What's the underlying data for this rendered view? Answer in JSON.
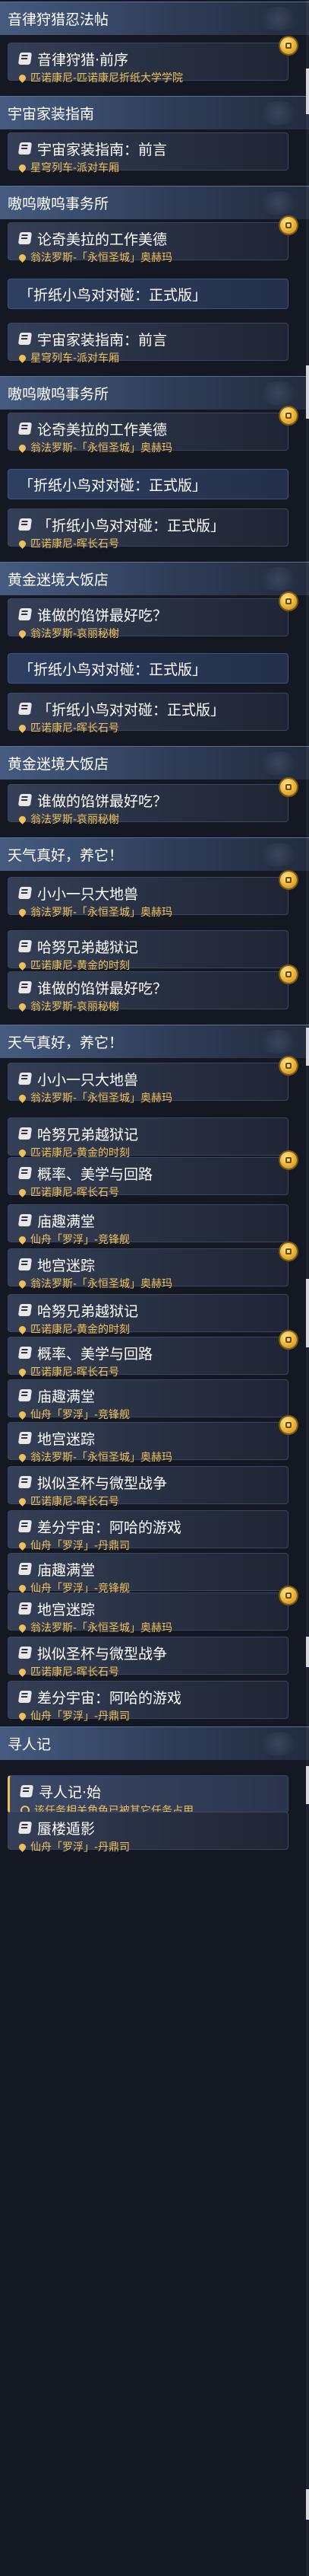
{
  "items": [
    {
      "type": "header",
      "text": "音律狩猎忍法帖"
    },
    {
      "type": "card",
      "title": "音律狩猎·前序",
      "sub": "匹诺康尼-匹诺康尼折纸大学学院",
      "icon": "pin",
      "badge": true
    },
    {
      "type": "header",
      "text": "宇宙家装指南"
    },
    {
      "type": "card",
      "title": "宇宙家装指南：前言",
      "sub": "星穹列车-派对车厢",
      "icon": "pin",
      "badge": false
    },
    {
      "type": "header",
      "text": "嗷呜嗷呜事务所"
    },
    {
      "type": "card",
      "title": "论奇美拉的工作美德",
      "sub": "翁法罗斯-「永恒圣城」奥赫玛",
      "icon": "pin",
      "badge": true
    },
    {
      "type": "banner",
      "title": "「折纸小鸟对对碰：正式版」"
    },
    {
      "type": "card",
      "title": "宇宙家装指南：前言",
      "sub": "星穹列车-派对车厢",
      "icon": "pin",
      "badge": false
    },
    {
      "type": "header",
      "text": "嗷呜嗷呜事务所"
    },
    {
      "type": "card",
      "title": "论奇美拉的工作美德",
      "sub": "翁法罗斯-「永恒圣城」奥赫玛",
      "icon": "pin",
      "badge": true
    },
    {
      "type": "banner",
      "title": "「折纸小鸟对对碰：正式版」"
    },
    {
      "type": "card",
      "title": "「折纸小鸟对对碰：正式版」",
      "sub": "匹诺康尼-晖长石号",
      "icon": "pin",
      "badge": false
    },
    {
      "type": "header",
      "text": "黄金迷境大饭店"
    },
    {
      "type": "card",
      "title": "谁做的馅饼最好吃？",
      "sub": "翁法罗斯-哀丽秘榭",
      "icon": "pin",
      "badge": true
    },
    {
      "type": "banner",
      "title": "「折纸小鸟对对碰：正式版」"
    },
    {
      "type": "card",
      "title": "「折纸小鸟对对碰：正式版」",
      "sub": "匹诺康尼-晖长石号",
      "icon": "pin",
      "badge": false
    },
    {
      "type": "header",
      "text": "黄金迷境大饭店"
    },
    {
      "type": "card",
      "title": "谁做的馅饼最好吃？",
      "sub": "翁法罗斯-哀丽秘榭",
      "icon": "pin",
      "badge": true
    },
    {
      "type": "header",
      "text": "天气真好，养它！"
    },
    {
      "type": "card",
      "title": "小小一只大地兽",
      "sub": "翁法罗斯-「永恒圣城」奥赫玛",
      "icon": "pin",
      "badge": true
    },
    {
      "type": "card",
      "title": "哈努兄弟越狱记",
      "sub": "匹诺康尼-黄金的时刻",
      "icon": "pin",
      "badge": false
    },
    {
      "type": "card",
      "title": "谁做的馅饼最好吃？",
      "sub": "翁法罗斯-哀丽秘榭",
      "icon": "pin",
      "badge": true
    },
    {
      "type": "header",
      "text": "天气真好，养它！"
    },
    {
      "type": "card",
      "title": "小小一只大地兽",
      "sub": "翁法罗斯-「永恒圣城」奥赫玛",
      "icon": "pin",
      "badge": true
    },
    {
      "type": "card",
      "title": "哈努兄弟越狱记",
      "sub": "匹诺康尼-黄金的时刻",
      "icon": "pin",
      "badge": false
    },
    {
      "type": "card",
      "title": "概率、美学与回路",
      "sub": "匹诺康尼-晖长石号",
      "icon": "pin",
      "badge": true
    },
    {
      "type": "card",
      "title": "庙趣满堂",
      "sub": "仙舟「罗浮」-竞锋舰",
      "icon": "pin",
      "badge": false
    },
    {
      "type": "card",
      "title": "地宫迷踪",
      "sub": "翁法罗斯-「永恒圣城」奥赫玛",
      "icon": "pin",
      "badge": true
    },
    {
      "type": "card",
      "title": "哈努兄弟越狱记",
      "sub": "匹诺康尼-黄金的时刻",
      "icon": "pin",
      "badge": false
    },
    {
      "type": "card",
      "title": "概率、美学与回路",
      "sub": "匹诺康尼-晖长石号",
      "icon": "pin",
      "badge": true
    },
    {
      "type": "card",
      "title": "庙趣满堂",
      "sub": "仙舟「罗浮」-竞锋舰",
      "icon": "pin",
      "badge": false
    },
    {
      "type": "card",
      "title": "地宫迷踪",
      "sub": "翁法罗斯-「永恒圣城」奥赫玛",
      "icon": "pin",
      "badge": true
    },
    {
      "type": "card",
      "title": "拟似圣杯与微型战争",
      "sub": "匹诺康尼-晖长石号",
      "icon": "pin",
      "badge": false
    },
    {
      "type": "card",
      "title": "差分宇宙：阿哈的游戏",
      "sub": "仙舟「罗浮」-丹鼎司",
      "icon": "pin",
      "badge": false
    },
    {
      "type": "card",
      "title": "庙趣满堂",
      "sub": "仙舟「罗浮」-竞锋舰",
      "icon": "pin",
      "badge": false
    },
    {
      "type": "card",
      "title": "地宫迷踪",
      "sub": "翁法罗斯-「永恒圣城」奥赫玛",
      "icon": "pin",
      "badge": true
    },
    {
      "type": "card",
      "title": "拟似圣杯与微型战争",
      "sub": "匹诺康尼-晖长石号",
      "icon": "pin",
      "badge": false
    },
    {
      "type": "card",
      "title": "差分宇宙：阿哈的游戏",
      "sub": "仙舟「罗浮」-丹鼎司",
      "icon": "pin",
      "badge": false
    },
    {
      "type": "header",
      "text": "寻人记"
    },
    {
      "type": "card",
      "title": "寻人记·始",
      "sub": "该任务相关角色已被其它任务占用",
      "icon": "warn",
      "badge": false,
      "selected": true
    },
    {
      "type": "card",
      "title": "蜃楼遁影",
      "sub": "仙舟「罗浮」-丹鼎司",
      "icon": "pin",
      "badge": false
    }
  ]
}
